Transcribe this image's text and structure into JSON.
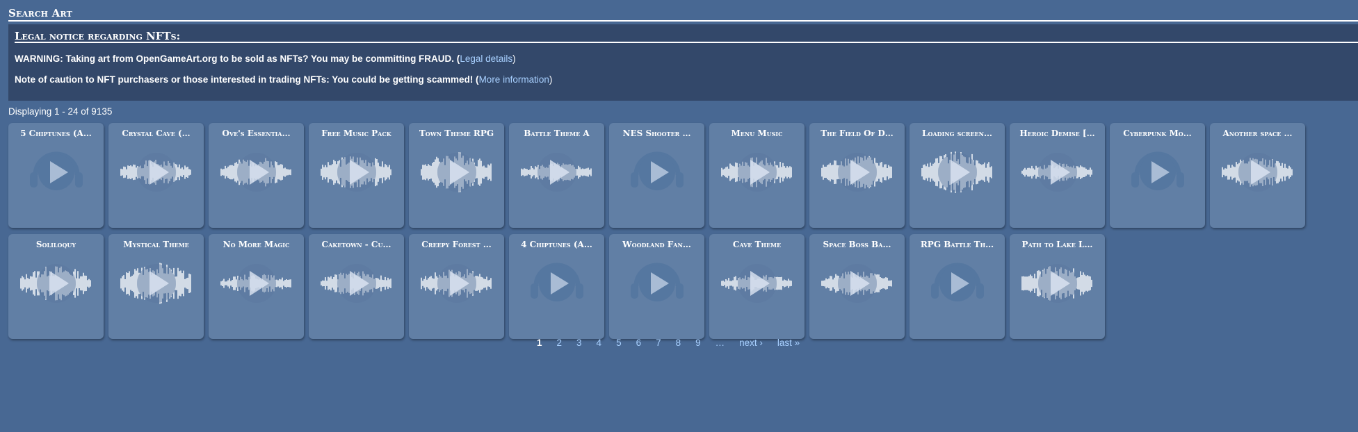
{
  "page": {
    "section_title": "Search Art"
  },
  "legal": {
    "title": "Legal notice regarding NFTs:",
    "warning_text": "WARNING: Taking art from OpenGameArt.org to be sold as NFTs? You may be committing FRAUD. (",
    "warning_link": "Legal details",
    "warning_close": ")",
    "caution_text": "Note of caution to NFT purchasers or those interested in trading NFTs: You could be getting scammed! (",
    "caution_link": "More information",
    "caution_close": ")"
  },
  "results": {
    "displaying": "Displaying 1 - 24 of 9135"
  },
  "items": [
    {
      "title": "5 Chiptunes (A…",
      "art": "headphones"
    },
    {
      "title": "Crystal Cave (…",
      "art": "waveform"
    },
    {
      "title": "Ove's Essentia…",
      "art": "waveform"
    },
    {
      "title": "Free Music Pack",
      "art": "waveform"
    },
    {
      "title": "Town Theme RPG",
      "art": "waveform"
    },
    {
      "title": "Battle Theme A",
      "art": "waveform"
    },
    {
      "title": "NES Shooter …",
      "art": "headphones"
    },
    {
      "title": "Menu Music",
      "art": "waveform"
    },
    {
      "title": "The Field Of D…",
      "art": "waveform"
    },
    {
      "title": "Loading screen…",
      "art": "waveform"
    },
    {
      "title": "Heroic Demise […",
      "art": "waveform"
    },
    {
      "title": "Cyberpunk Mo…",
      "art": "headphones"
    },
    {
      "title": "Another space …",
      "art": "waveform"
    },
    {
      "title": "Soliloquy",
      "art": "waveform"
    },
    {
      "title": "Mystical Theme",
      "art": "waveform"
    },
    {
      "title": "No More Magic",
      "art": "waveform"
    },
    {
      "title": "Caketown - Cu…",
      "art": "waveform"
    },
    {
      "title": "Creepy Forest …",
      "art": "waveform"
    },
    {
      "title": "4 Chiptunes (A…",
      "art": "headphones"
    },
    {
      "title": "Woodland Fan…",
      "art": "headphones"
    },
    {
      "title": "Cave Theme",
      "art": "waveform"
    },
    {
      "title": "Space Boss Ba…",
      "art": "waveform"
    },
    {
      "title": "RPG Battle Th…",
      "art": "headphones"
    },
    {
      "title": "Path to Lake L…",
      "art": "waveform"
    }
  ],
  "pagination": {
    "pages": [
      "1",
      "2",
      "3",
      "4",
      "5",
      "6",
      "7",
      "8",
      "9"
    ],
    "current": "1",
    "ellipsis": "…",
    "next": "next ›",
    "last": "last »"
  },
  "colors": {
    "background": "#486893",
    "legal_box": "#33486a",
    "tile": "#617fa5",
    "link": "#a8d0ff"
  }
}
